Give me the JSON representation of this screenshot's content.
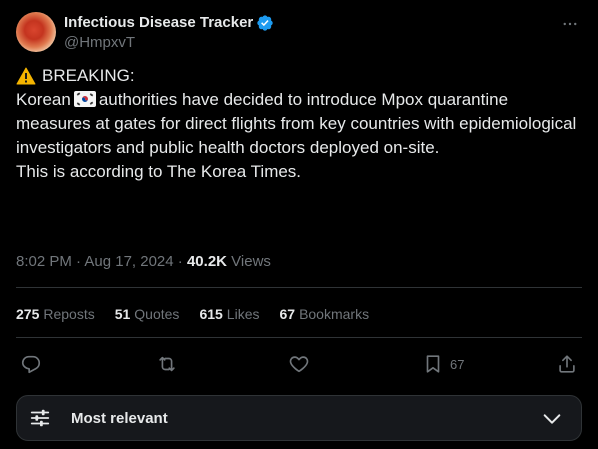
{
  "author": {
    "display_name": "Infectious Disease Tracker",
    "handle": "@HmpxvT",
    "verified_color": "#1d9bf0"
  },
  "post": {
    "breaking_label": "BREAKING:",
    "paragraph1_before_flag": "Korean",
    "paragraph1_after_flag": "authorities have decided to introduce Mpox quarantine measures at gates for direct flights from key countries with epidemiological investigators and public health doctors deployed on-site.",
    "paragraph2": "This is according to The Korea Times.",
    "warning_emoji": "warning-icon",
    "flag_emoji": "south-korea-flag-icon"
  },
  "meta": {
    "timestamp": "8:02 PM · Aug 17, 2024",
    "separator": "·",
    "views_count": "40.2K",
    "views_label": "Views"
  },
  "stats": [
    {
      "count": "275",
      "label": "Reposts"
    },
    {
      "count": "51",
      "label": "Quotes"
    },
    {
      "count": "615",
      "label": "Likes"
    },
    {
      "count": "67",
      "label": "Bookmarks"
    }
  ],
  "actions": {
    "bookmark_count": "67"
  },
  "sort": {
    "label": "Most relevant"
  },
  "colors": {
    "background": "#000000",
    "text_primary": "#e7e9ea",
    "text_secondary": "#71767b",
    "divider": "#2f3336",
    "accent": "#1d9bf0"
  }
}
